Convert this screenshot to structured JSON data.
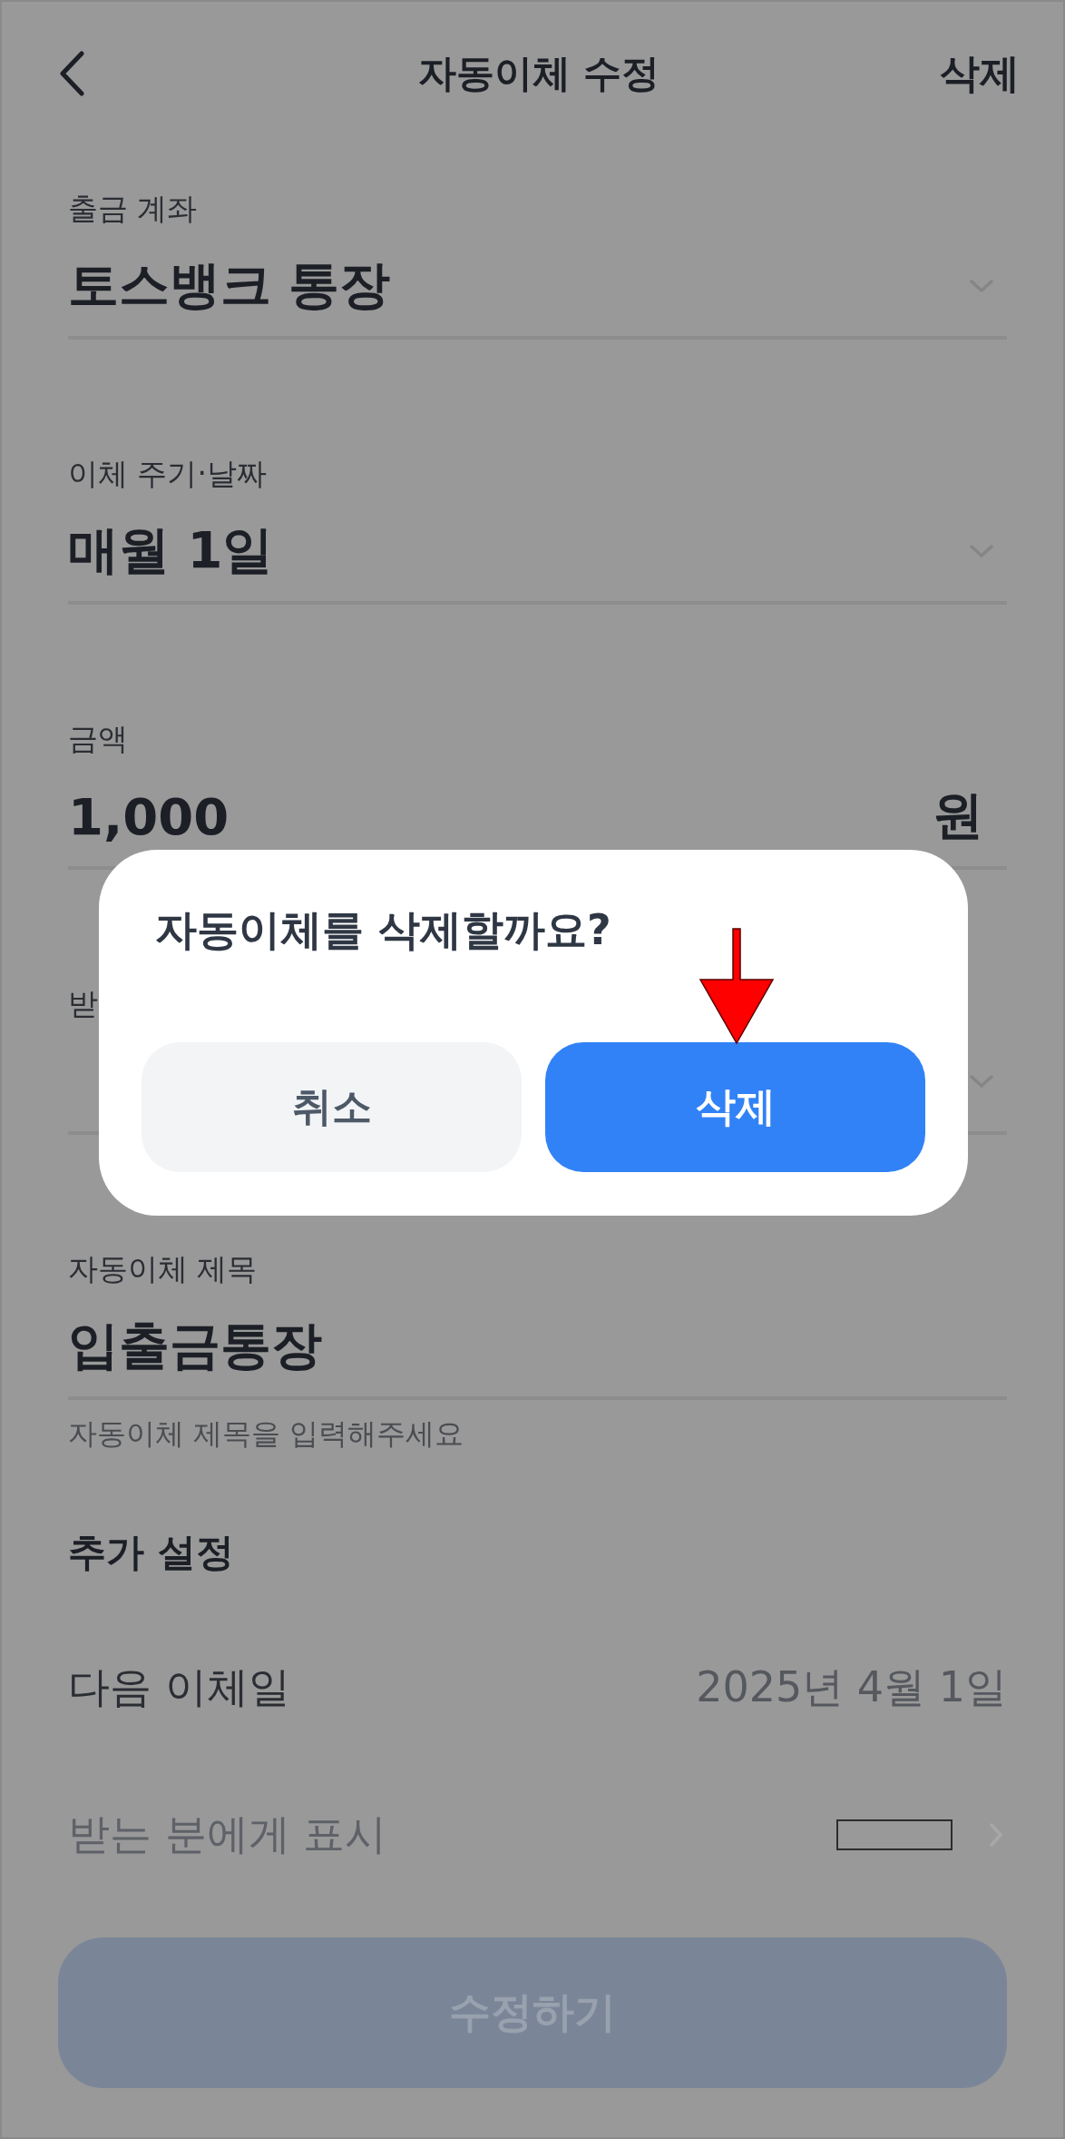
{
  "header": {
    "title": "자동이체 수정",
    "action": "삭제"
  },
  "fields": [
    {
      "kind": "select",
      "label": "출금 계좌",
      "value": "토스뱅크 통장"
    },
    {
      "kind": "select",
      "label": "이체 주기·날짜",
      "value": "매월 1일"
    },
    {
      "kind": "amount",
      "label": "금액",
      "value": "1,000",
      "unit": "원"
    },
    {
      "kind": "select",
      "label": "받"
    },
    {
      "kind": "text",
      "label": "자동이체 제목",
      "value": "입출금통장",
      "helper": "자동이체 제목을 입력해주세요"
    }
  ],
  "extra": {
    "title": "추가 설정",
    "rows": [
      {
        "kind": "value",
        "label": "다음 이체일",
        "value": "2025년 4월 1일"
      },
      {
        "kind": "link",
        "label": "받는 분에게 표시"
      }
    ]
  },
  "submit": {
    "label": "수정하기",
    "disabled": true
  },
  "dialog": {
    "title": "자동이체를 삭제할까요?",
    "buttons": [
      {
        "kind": "secondary",
        "label": "취소"
      },
      {
        "kind": "primary",
        "label": "삭제"
      }
    ]
  }
}
